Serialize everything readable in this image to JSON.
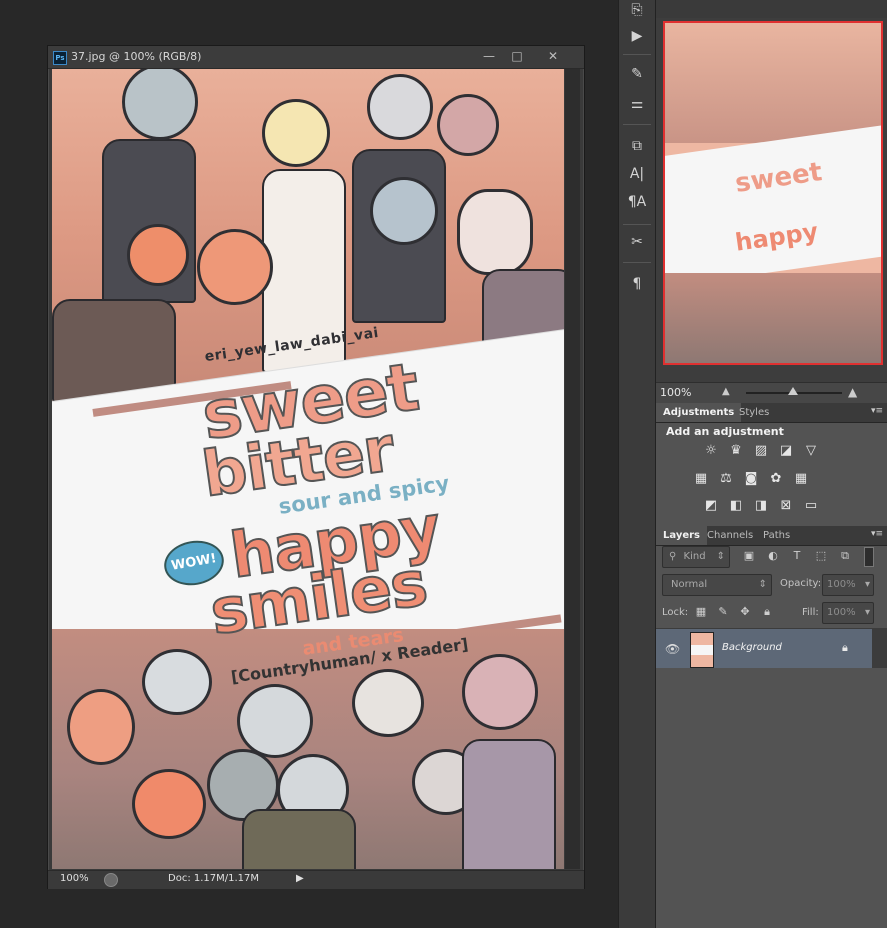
{
  "document": {
    "title": "37.jpg @ 100% (RGB/8)",
    "ps_badge": "Ps",
    "controls": {
      "minimize": "—",
      "maximize": "□",
      "close": "✕"
    },
    "status": {
      "zoom": "100%",
      "doc_info": "Doc: 1.17M/1.17M",
      "arrow_icon": "▶"
    }
  },
  "artwork": {
    "username": "eri_yew_law_dabi_vai",
    "title_line1": "sweet",
    "title_line2": "bitter",
    "subtitle": "sour and spicy",
    "title_line3": "happy",
    "title_line4": "smiles",
    "tagline": "and tears",
    "category": "[Countryhuman/ x Reader]",
    "wow": "WOW!"
  },
  "toolstrip": {
    "icons": [
      "history-brush-icon",
      "play-icon",
      "brush-options-icon",
      "adjust-sliders-icon",
      "clone-source-icon",
      "character-icon",
      "paragraph-style-icon",
      "tool-presets-icon",
      "paragraph-icon"
    ],
    "glyphs": [
      "⎘",
      "▶",
      "✎",
      "⚌",
      "⧉",
      "A|",
      "¶A",
      "✂",
      "¶"
    ]
  },
  "navigator": {
    "zoom": "100%"
  },
  "adjustments_panel": {
    "tabs": [
      "Adjustments",
      "Styles"
    ],
    "title": "Add an adjustment",
    "row1": [
      "☼",
      "♛",
      "▨",
      "◪",
      "▽"
    ],
    "row2": [
      "▦",
      "⚖",
      "◙",
      "✿",
      "▦"
    ],
    "row3": [
      "◩",
      "◧",
      "◨",
      "⊠",
      "▭"
    ]
  },
  "layers_panel": {
    "tabs": [
      "Layers",
      "Channels",
      "Paths"
    ],
    "filter_kind": "Kind",
    "blend_mode": "Normal",
    "opacity_label": "Opacity:",
    "opacity_value": "100%",
    "lock_label": "Lock:",
    "fill_label": "Fill:",
    "fill_value": "100%",
    "layer_name": "Background"
  },
  "colors": {
    "ui_dark": "#282828",
    "panel": "#535353",
    "selected_layer": "#5d6877",
    "nav_frame": "#e03030"
  }
}
